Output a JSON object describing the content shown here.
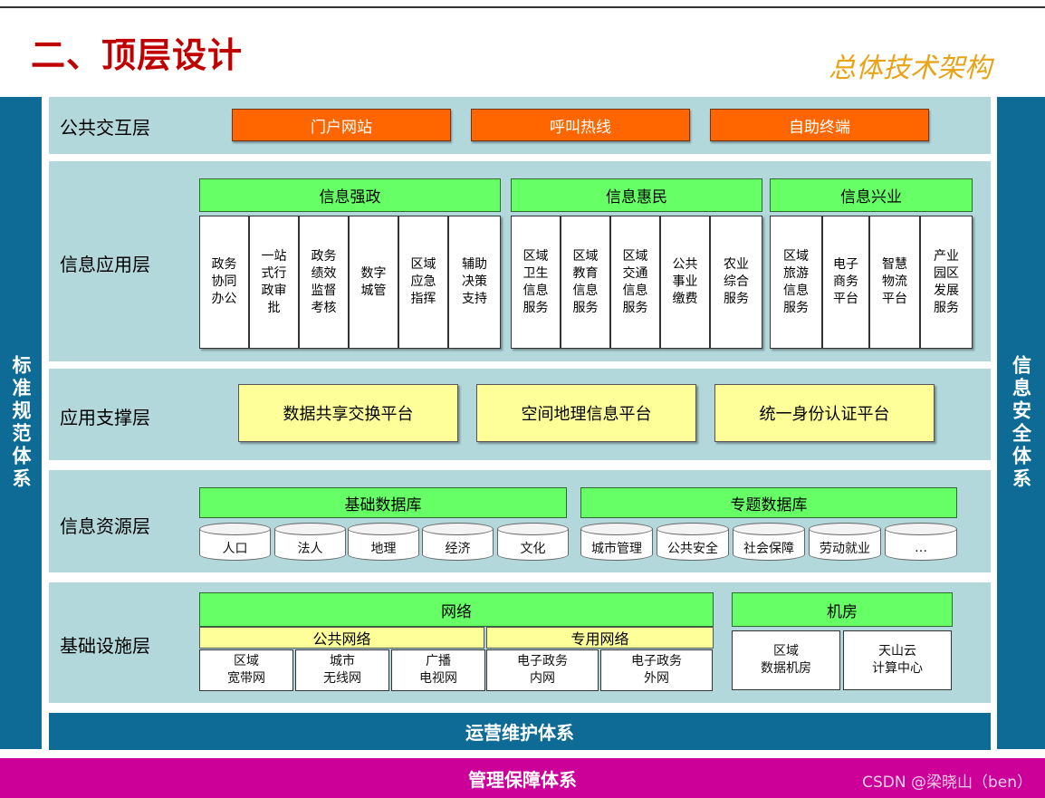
{
  "title": "二、顶层设计",
  "subtitle": "总体技术架构",
  "left_side": "标准规范体系",
  "right_side": "信息安全体系",
  "layers": {
    "interaction": {
      "label": "公共交互层",
      "items": [
        "门户网站",
        "呼叫热线",
        "自助终端"
      ]
    },
    "application": {
      "label": "信息应用层",
      "groups": [
        {
          "name": "信息强政",
          "items": [
            "政务\n协同\n办公",
            "一站\n式行\n政审\n批",
            "政务\n绩效\n监督\n考核",
            "数字\n城管",
            "区域\n应急\n指挥",
            "辅助\n决策\n支持"
          ]
        },
        {
          "name": "信息惠民",
          "items": [
            "区域\n卫生\n信息\n服务",
            "区域\n教育\n信息\n服务",
            "区域\n交通\n信息\n服务",
            "公共\n事业\n缴费",
            "农业\n综合\n服务"
          ]
        },
        {
          "name": "信息兴业",
          "items": [
            "区域\n旅游\n信息\n服务",
            "电子\n商务\n平台",
            "智慧\n物流\n平台",
            "产业\n园区\n发展\n服务"
          ]
        }
      ]
    },
    "support": {
      "label": "应用支撑层",
      "items": [
        "数据共享交换平台",
        "空间地理信息平台",
        "统一身份认证平台"
      ]
    },
    "resource": {
      "label": "信息资源层",
      "groups": [
        {
          "name": "基础数据库",
          "items": [
            "人口",
            "法人",
            "地理",
            "经济",
            "文化"
          ]
        },
        {
          "name": "专题数据库",
          "items": [
            "城市管理",
            "公共安全",
            "社会保障",
            "劳动就业",
            "…"
          ]
        }
      ]
    },
    "infrastructure": {
      "label": "基础设施层",
      "network": "网络",
      "public_network": "公共网络",
      "private_network": "专用网络",
      "public_items": [
        "区域\n宽带网",
        "城市\n无线网",
        "广播\n电视网"
      ],
      "private_items": [
        "电子政务\n内网",
        "电子政务\n外网"
      ],
      "room": "机房",
      "room_items": [
        "区域\n数据机房",
        "天山云\n计算中心"
      ]
    }
  },
  "ops_bar": "运营维护体系",
  "mgmt_bar": "管理保障体系",
  "watermark": "CSDN @梁晓山（ben）"
}
